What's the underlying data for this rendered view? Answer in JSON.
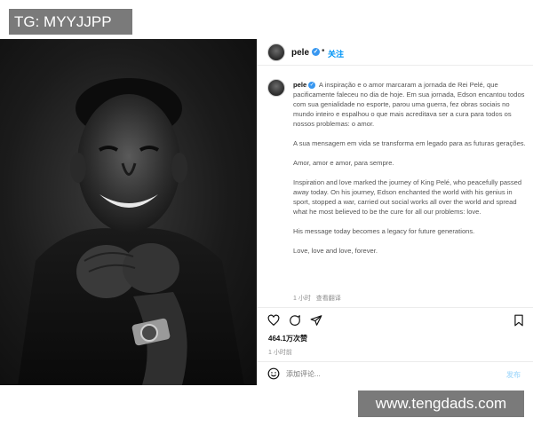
{
  "watermark_top": "TG: MYYJJPP",
  "watermark_bottom": "www.tengdads.com",
  "header": {
    "username": "pele",
    "separator": "•",
    "follow_label": "关注"
  },
  "caption": {
    "username": "pele",
    "paragraph1": "A inspiração e o amor marcaram a jornada de Rei Pelé, que pacificamente faleceu no dia de hoje. Em sua jornada, Edson encantou todos com sua genialidade no esporte, parou uma guerra, fez obras sociais no mundo inteiro e espalhou o que mais acreditava ser a cura para todos os nossos problemas: o amor.",
    "paragraph2": "A sua mensagem em vida se transforma em legado para as futuras gerações.",
    "paragraph3": "Amor, amor e amor, para sempre.",
    "paragraph4": "Inspiration and love marked the journey of King Pelé, who peacefully passed away today. On his journey, Edson enchanted the world with his genius in sport, stopped a war, carried out social works all over the world and spread what he most believed to be the cure for all our problems: love.",
    "paragraph5": "His message today becomes a legacy for future generations.",
    "paragraph6": "Love, love and love, forever.",
    "meta_time": "1 小时",
    "meta_translate": "查看翻译"
  },
  "likes": "464.1万次赞",
  "time_ago": "1 小时前",
  "comment": {
    "placeholder": "添加评论...",
    "post_label": "发布"
  },
  "icons": {
    "like": "heart-icon",
    "comment": "comment-icon",
    "share": "send-icon",
    "save": "bookmark-icon",
    "emoji": "emoji-icon"
  },
  "colors": {
    "verified": "#3897f0",
    "follow": "#0095f6",
    "post_disabled": "#b2dffc",
    "watermark_bg": "#7a7a7a"
  }
}
